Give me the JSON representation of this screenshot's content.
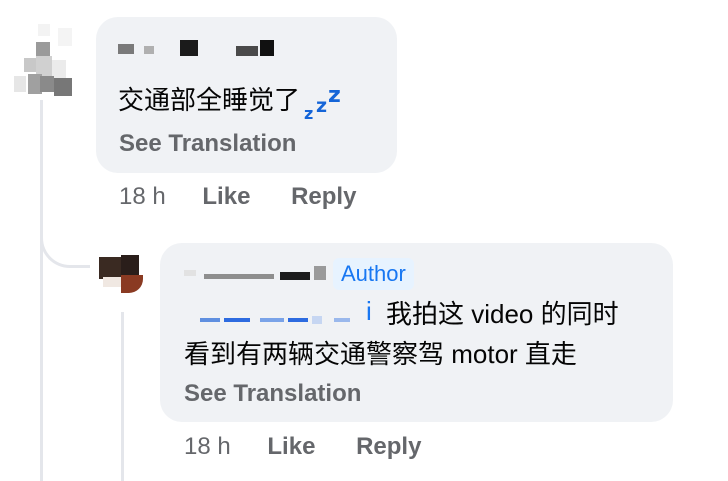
{
  "comment1": {
    "text": "交通部全睡觉了",
    "emoji": "zzz-emoji",
    "see_translation": "See Translation",
    "time": "18 h",
    "like": "Like",
    "reply": "Reply"
  },
  "comment2": {
    "badge": "Author",
    "mention_tail": "i",
    "text_line1": "我拍这 video 的同时",
    "text_line2": "看到有两辆交通警察驾 motor 直走",
    "see_translation": "See Translation",
    "time": "18 h",
    "like": "Like",
    "reply": "Reply"
  },
  "colors": {
    "bubble": "#f0f2f5",
    "secondary_text": "#65676b",
    "author_badge_bg": "#e7f3ff",
    "author_badge_text": "#1877f2",
    "mention": "#1877f2"
  }
}
